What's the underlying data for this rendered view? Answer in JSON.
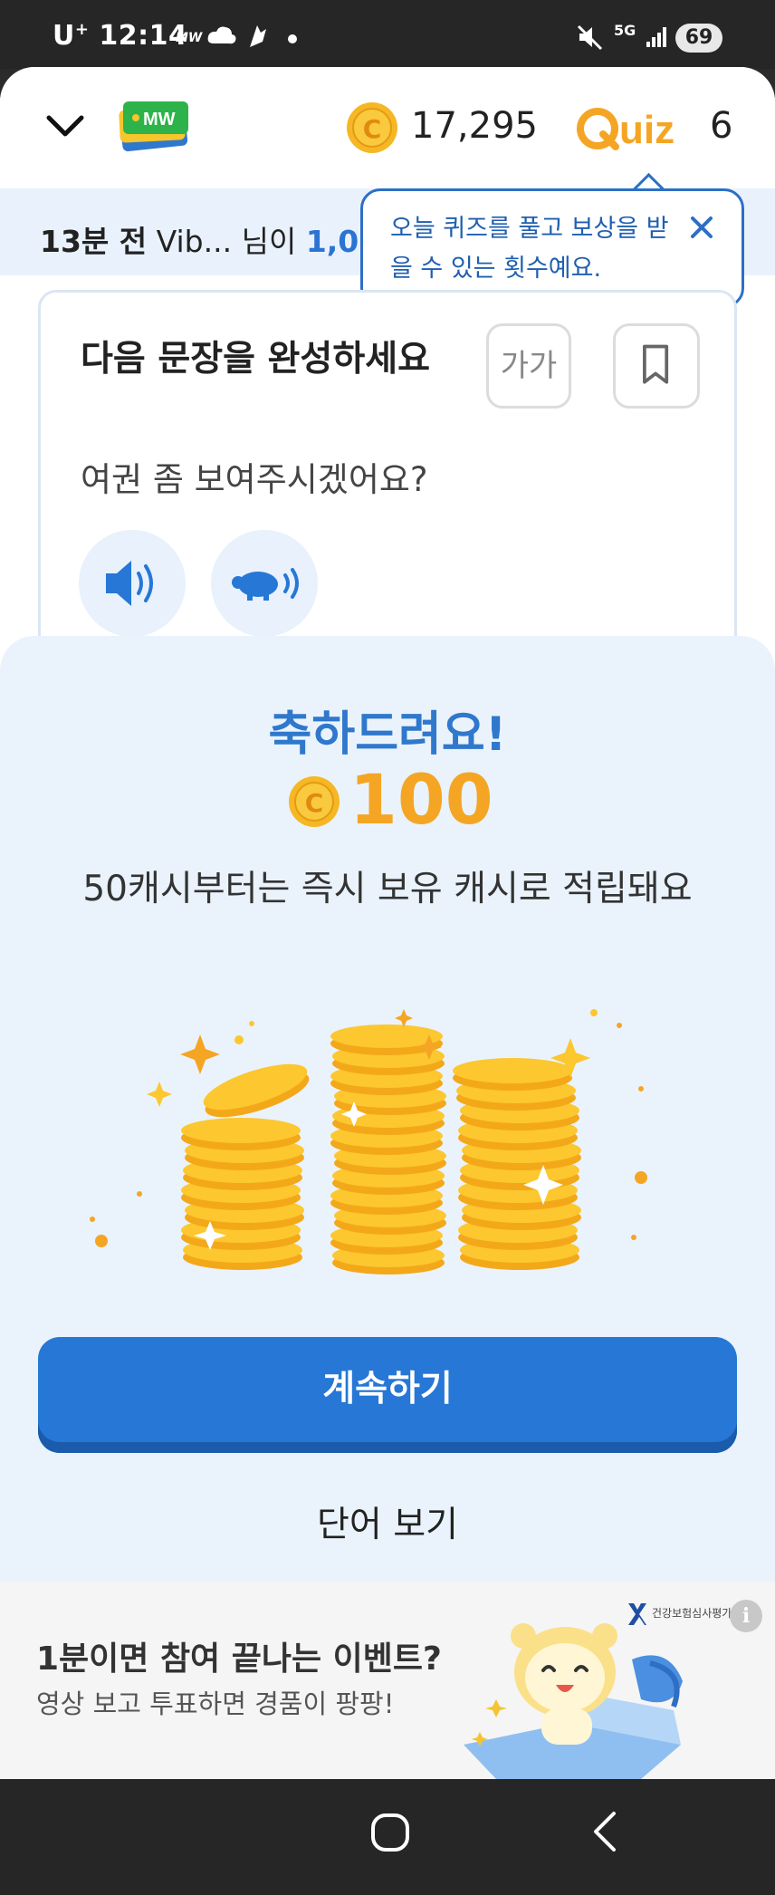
{
  "status_bar": {
    "carrier": "U",
    "carrier_plus": "+",
    "time": "12:14",
    "app_indicator": "MW",
    "network": "5G",
    "battery": "69"
  },
  "header": {
    "coin_count": "17,295",
    "quiz_logo_text": "Quiz",
    "quiz_count": "6",
    "logo_text": "MW"
  },
  "ticker": {
    "time_ago": "13분 전",
    "user": "Vib...",
    "suffix": "님이",
    "amount_partial": "1,0"
  },
  "tooltip": {
    "text": "오늘 퀴즈를 풀고 보상을 받을 수 있는 횟수예요."
  },
  "quiz_card": {
    "title": "다음 문장을 완성하세요",
    "font_size_button": "가가",
    "sentence": "여권 좀 보여주시겠어요?"
  },
  "reward_sheet": {
    "title": "축하드려요!",
    "amount": "100",
    "description": "50캐시부터는 즉시 보유 캐시로 적립돼요",
    "continue_label": "계속하기",
    "word_view_label": "단어 보기"
  },
  "ad": {
    "title": "1분이면 참여 끝나는 이벤트?",
    "subtitle": "영상 보고 투표하면 경품이 팡팡!",
    "sponsor": "건강보험심사평가원",
    "info": "i"
  },
  "colors": {
    "primary_blue": "#2677d6",
    "coin_orange": "#f5a524",
    "sheet_bg": "#eaf3fc"
  },
  "icons": [
    "chevron-down-icon",
    "coin-icon",
    "quiz-logo",
    "close-icon",
    "bookmark-icon",
    "speaker-icon",
    "turtle-speaker-icon",
    "home-icon",
    "back-icon"
  ]
}
